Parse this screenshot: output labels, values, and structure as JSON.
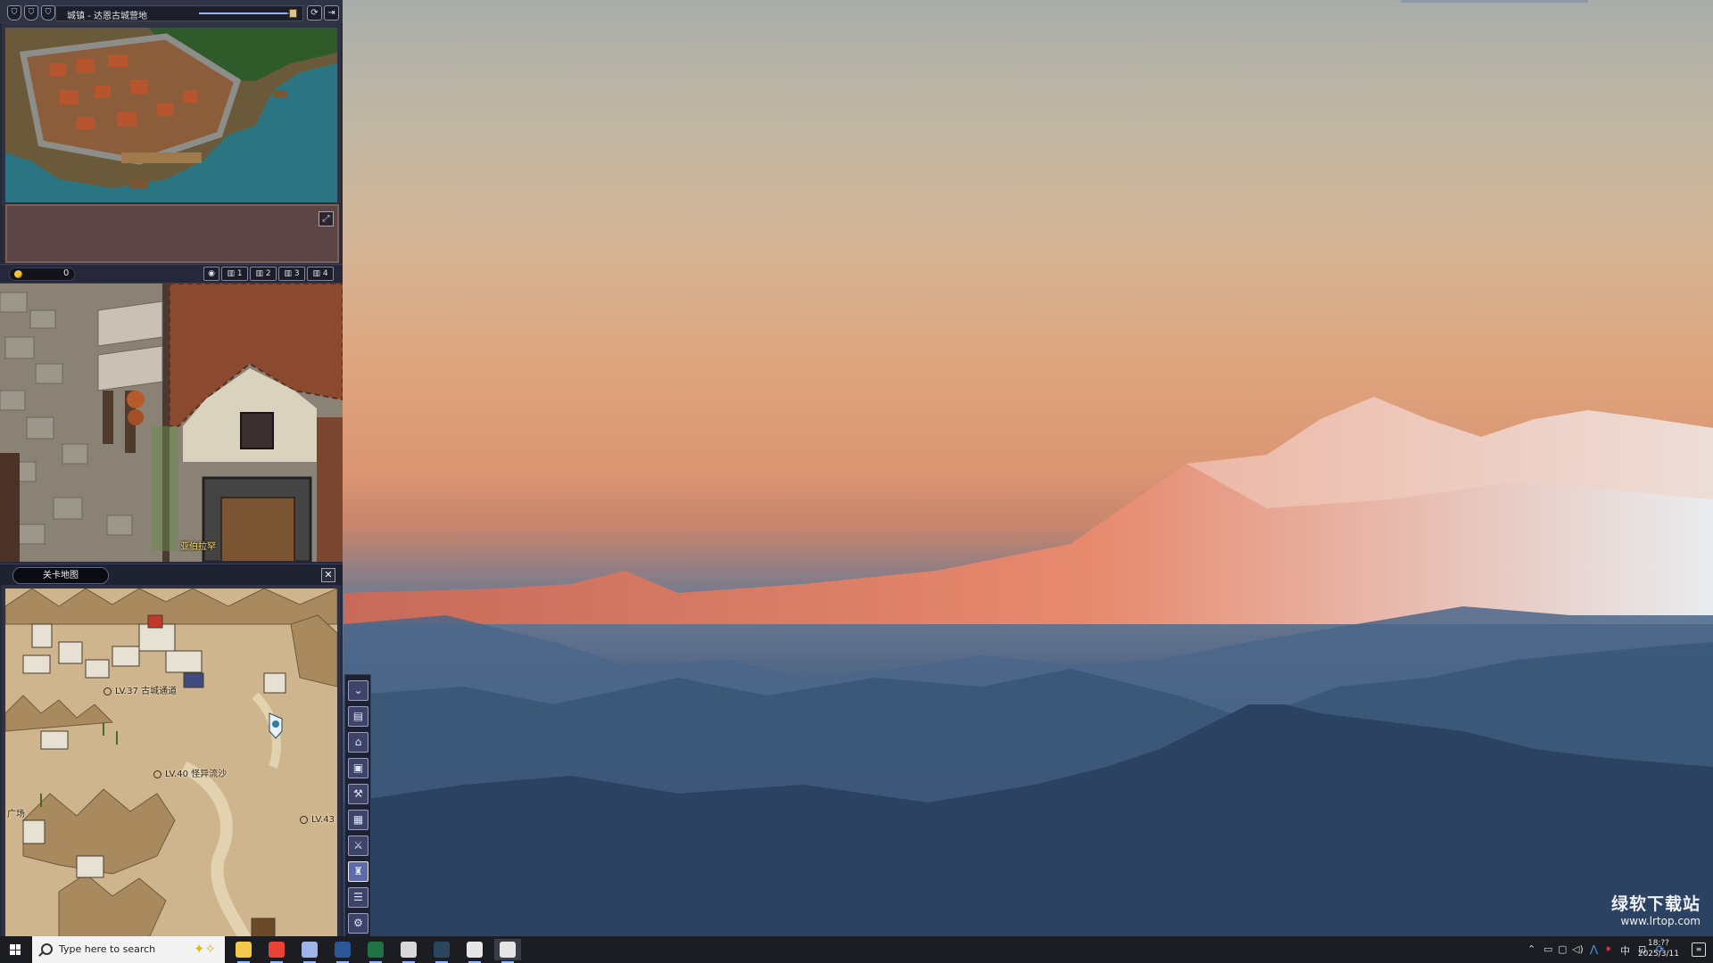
{
  "window": {
    "title": "城镇 - 达恩古城营地",
    "volume_level": 0.95,
    "titlebar_icons": [
      "shield-icon",
      "shield-icon",
      "shield-icon"
    ],
    "buttons": {
      "refresh": "⟳",
      "exit": "⇥"
    }
  },
  "chat": {
    "expand_label": "⤢"
  },
  "status": {
    "gold": "0",
    "channels": [
      "1",
      "2",
      "3",
      "4"
    ],
    "filter_icon": "eye-icon"
  },
  "town": {
    "npc_name": "亚伯拉罕"
  },
  "map_panel": {
    "tab_label": "关卡地图",
    "close_label": "✕",
    "labels": [
      {
        "id": "lv37",
        "text": "LV.37 古城通道"
      },
      {
        "id": "lv40",
        "text": "LV.40 怪异流沙"
      },
      {
        "id": "lv43",
        "text": "LV.43"
      },
      {
        "id": "square",
        "text": "广场"
      }
    ]
  },
  "toolbar": {
    "buttons": [
      {
        "name": "collapse-button",
        "glyph": "⌄"
      },
      {
        "name": "shop-button",
        "glyph": "▤"
      },
      {
        "name": "home-button",
        "glyph": "⌂"
      },
      {
        "name": "storage-button",
        "glyph": "▣"
      },
      {
        "name": "craft-button",
        "glyph": "⚒"
      },
      {
        "name": "inventory-button",
        "glyph": "▦"
      },
      {
        "name": "skill-button",
        "glyph": "⚔"
      },
      {
        "name": "guild-button",
        "glyph": "♜"
      },
      {
        "name": "quest-button",
        "glyph": "☰"
      },
      {
        "name": "settings-button",
        "glyph": "⚙"
      }
    ],
    "active_index": 7
  },
  "taskbar": {
    "search_placeholder": "Type here to search",
    "apps": [
      {
        "name": "file-explorer",
        "color": "#f2c94c"
      },
      {
        "name": "chrome",
        "color": "#e94235"
      },
      {
        "name": "app-circle",
        "color": "#9fb4e8"
      },
      {
        "name": "word",
        "color": "#2b5797"
      },
      {
        "name": "excel",
        "color": "#1f7244"
      },
      {
        "name": "unity",
        "color": "#d8d8d8"
      },
      {
        "name": "steam",
        "color": "#2a475e"
      },
      {
        "name": "game-skull",
        "color": "#e6e6e6"
      },
      {
        "name": "hourglass-game",
        "color": "#e6e6e6"
      }
    ],
    "clock_time": "18:??",
    "clock_date": "2025/3/11"
  },
  "watermark": {
    "title": "绿软下载站",
    "url": "www.lrtop.com"
  },
  "colors": {
    "desktop_sky": "#d5b596",
    "game_frame": "#2e3244",
    "taskbar": "#1b1d23",
    "accent": "#8fb3ff"
  }
}
